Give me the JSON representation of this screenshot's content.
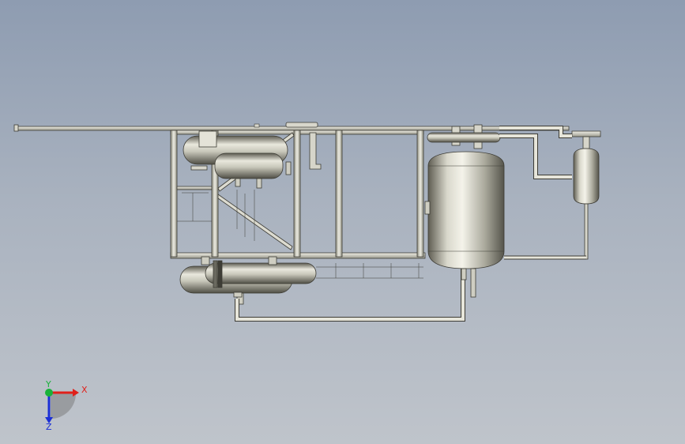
{
  "viewport": {
    "background_top": "#8e9cb1",
    "background_bottom": "#bfc4cb"
  },
  "model": {
    "description_name": "process-skid-assembly"
  },
  "triad": {
    "x_label": "X",
    "y_label": "Y",
    "z_label": "Z",
    "x_color": "#e0201a",
    "y_color": "#19b23a",
    "z_color": "#1b2fd6"
  }
}
